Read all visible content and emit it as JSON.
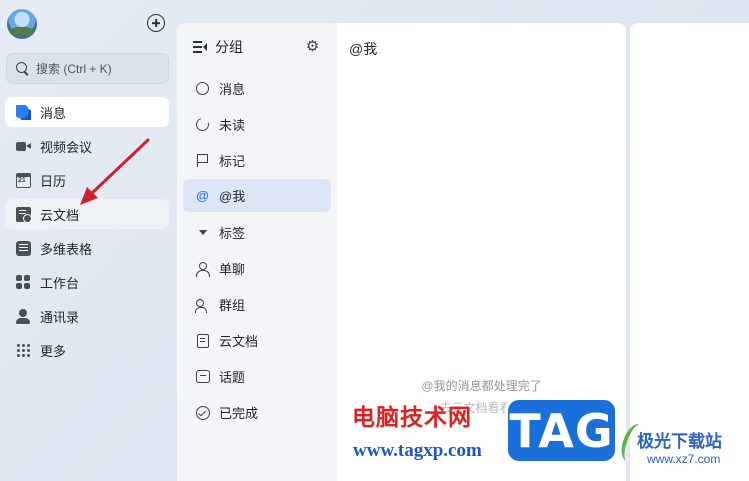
{
  "sidebar": {
    "search_placeholder": "搜索 (Ctrl + K)",
    "items": [
      {
        "label": "消息",
        "icon": "message-icon",
        "active": true
      },
      {
        "label": "视频会议",
        "icon": "video-meeting-icon"
      },
      {
        "label": "日历",
        "icon": "calendar-icon"
      },
      {
        "label": "云文档",
        "icon": "cloud-doc-icon"
      },
      {
        "label": "多维表格",
        "icon": "sheet-icon"
      },
      {
        "label": "工作台",
        "icon": "workplace-icon"
      },
      {
        "label": "通讯录",
        "icon": "contacts-icon"
      },
      {
        "label": "更多",
        "icon": "more-icon"
      }
    ]
  },
  "filters": {
    "header_label": "分组",
    "items": [
      {
        "label": "消息",
        "icon": "message-circle-icon"
      },
      {
        "label": "未读",
        "icon": "unread-icon"
      },
      {
        "label": "标记",
        "icon": "flag-icon"
      },
      {
        "label": "@我",
        "icon": "at-icon",
        "active": true
      },
      {
        "label": "标签",
        "icon": "caret-down-icon"
      },
      {
        "label": "单聊",
        "icon": "person-icon"
      },
      {
        "label": "群组",
        "icon": "group-icon"
      },
      {
        "label": "云文档",
        "icon": "doc-icon"
      },
      {
        "label": "话题",
        "icon": "topic-icon"
      },
      {
        "label": "已完成",
        "icon": "check-circle-icon"
      }
    ]
  },
  "main": {
    "title": "@我",
    "empty_text": "@我的消息都处理完了",
    "empty_subtext": "去云文档看看吧"
  },
  "watermark": {
    "site_cn": "电脑技术网",
    "site_url": "www.tagxp.com",
    "tag": "TAG",
    "logo_cn": "极光下载站",
    "logo_url": "www.xz7.com"
  },
  "colors": {
    "accent": "#2f7cf6",
    "active_filter_bg": "#dde6f6",
    "annotation_arrow": "#d0202a"
  }
}
